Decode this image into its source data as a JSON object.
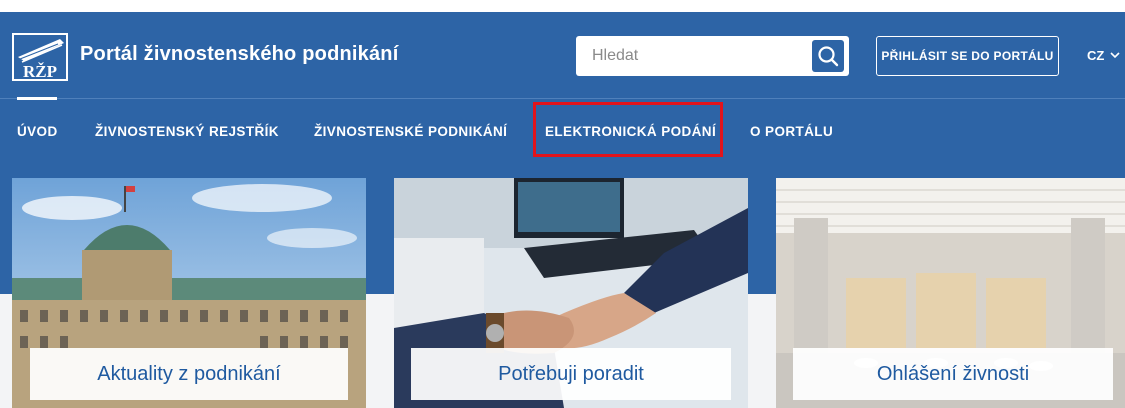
{
  "header": {
    "logo_text": "RŽP",
    "site_title": "Portál živnostenského podnikání",
    "search": {
      "placeholder": "Hledat",
      "value": ""
    },
    "login_button": "PŘIHLÁSIT SE DO PORTÁLU",
    "language": "CZ"
  },
  "nav": {
    "items": [
      {
        "label": "ÚVOD",
        "active": true
      },
      {
        "label": "ŽIVNOSTENSKÝ REJSTŘÍK"
      },
      {
        "label": "ŽIVNOSTENSKÉ PODNIKÁNÍ"
      },
      {
        "label": "ELEKTRONICKÁ PODÁNÍ",
        "highlighted": true
      },
      {
        "label": "O PORTÁLU"
      }
    ]
  },
  "tiles": [
    {
      "label": "Aktuality z podnikání",
      "image": "historic-building-photo"
    },
    {
      "label": "Potřebuji poradit",
      "image": "handshake-photo"
    },
    {
      "label": "Ohlášení živnosti",
      "image": "office-interior-photo"
    }
  ],
  "colors": {
    "brand_blue": "#2d64a6",
    "highlight_red": "#e1141c",
    "tile_label_text": "#1f5aa0"
  }
}
